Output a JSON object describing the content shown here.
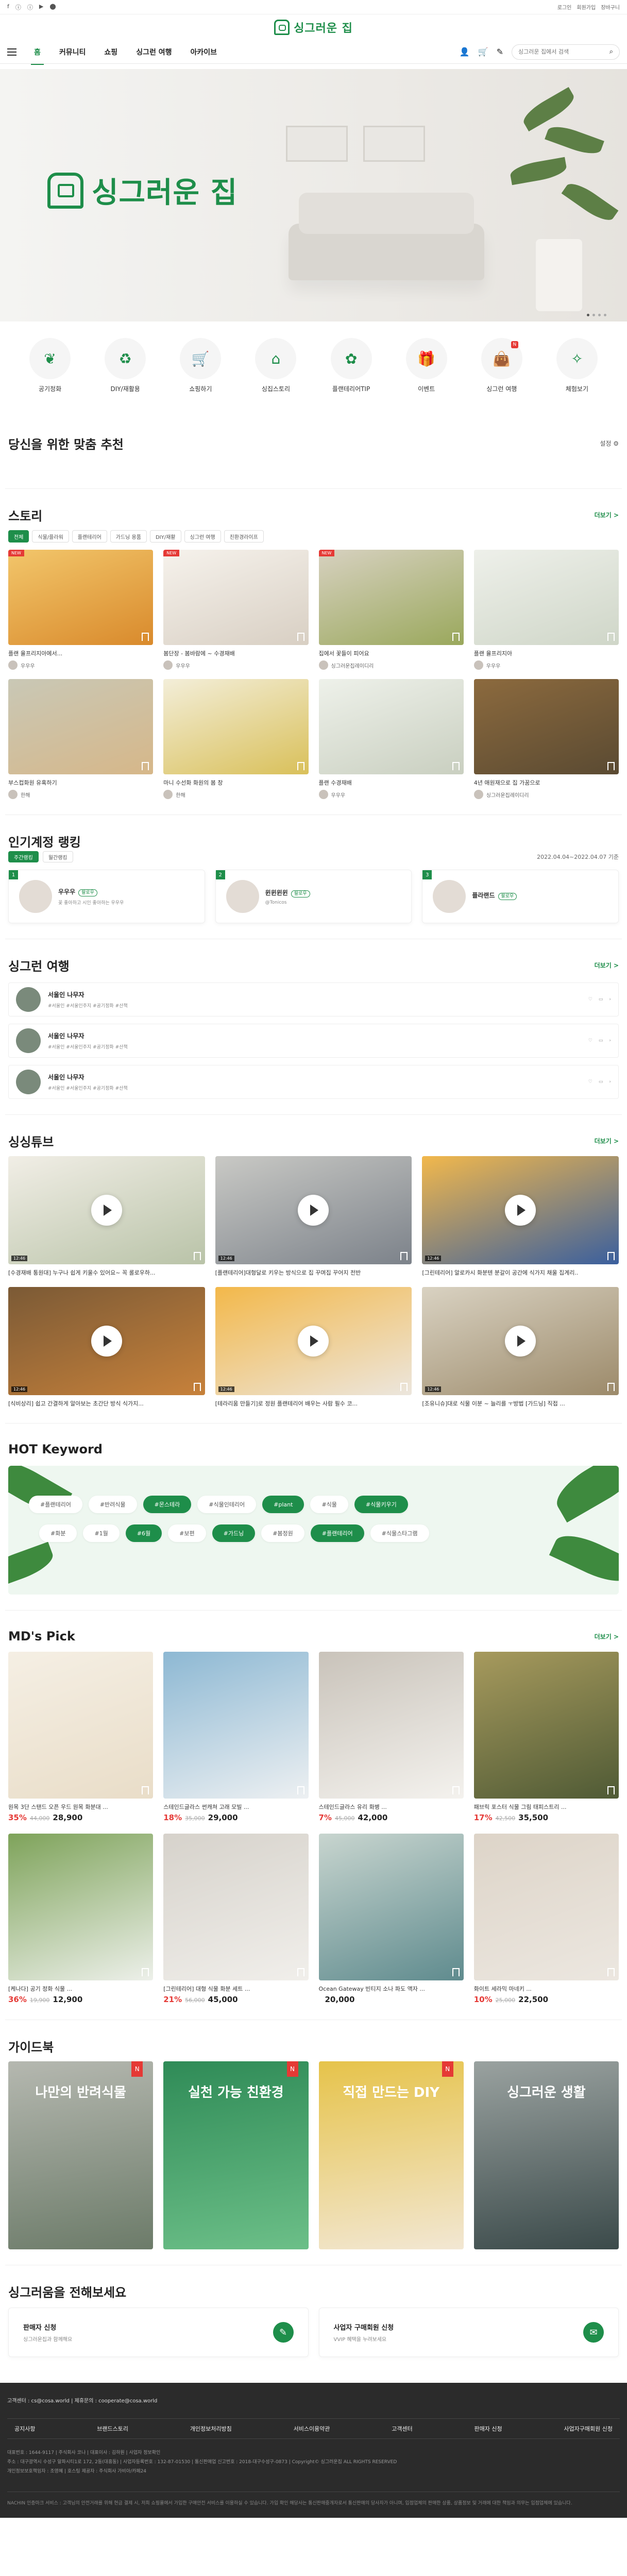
{
  "brand": {
    "name": "싱그러운 집",
    "hero_name": "싱그러운 집",
    "green": "#1e8e4a"
  },
  "util": {
    "left": [
      "f",
      "ⓘ",
      "ⓘ",
      "▶",
      "⬤"
    ],
    "right": [
      "로그인",
      "회원가입",
      "장바구니"
    ]
  },
  "nav": {
    "items": [
      "홈",
      "커뮤니티",
      "쇼핑",
      "싱그런 여행",
      "아카이브"
    ],
    "active": 0,
    "search_placeholder": "싱그러운 집에서 검색"
  },
  "quick": [
    {
      "label": "공기정화",
      "icon": "leaf-icon"
    },
    {
      "label": "DIY/재활용",
      "icon": "recycle-icon"
    },
    {
      "label": "쇼핑하기",
      "icon": "cart-icon"
    },
    {
      "label": "싱집스토리",
      "icon": "house-icon"
    },
    {
      "label": "플랜테리어TIP",
      "icon": "plant-icon"
    },
    {
      "label": "이벤트",
      "icon": "gift-icon"
    },
    {
      "label": "싱그런 여행",
      "icon": "bag-icon",
      "badge": "N"
    },
    {
      "label": "체험보기",
      "icon": "star-icon"
    }
  ],
  "reco": {
    "title": "당신을 위한 맞춤 추천",
    "right": "설정 ⚙"
  },
  "story": {
    "title": "스토리",
    "more": "더보기 >",
    "chips": [
      "전체",
      "식물/플라워",
      "플랜테리어",
      "가드닝 용품",
      "DIY/재활",
      "싱그런 여행",
      "친환경라이프"
    ],
    "cards": [
      {
        "title": "플랜 율프리지아에서...",
        "user": "우우우",
        "new": true,
        "colors": [
          "#d98a2c",
          "#f2c66b"
        ]
      },
      {
        "title": "봄단장 - 봄바람에 ~ 수경재배",
        "user": "우우우",
        "new": true,
        "colors": [
          "#d8cfc3",
          "#f6f2ec"
        ]
      },
      {
        "title": "집에서 꽃들이 피어요",
        "user": "싱그러운집레이디리",
        "new": true,
        "colors": [
          "#9aa85c",
          "#d7d1c0"
        ]
      },
      {
        "title": "플랜 율프리지아",
        "user": "우우우",
        "new": false,
        "colors": [
          "#cfd6c8",
          "#eef0ea"
        ]
      },
      {
        "title": "부스컵화원 유혹하기",
        "user": "한해",
        "new": false,
        "colors": [
          "#d6b789",
          "#c9c8b6"
        ]
      },
      {
        "title": "마니 수선화 화원의 봄 창",
        "user": "한해",
        "new": false,
        "colors": [
          "#d9c05a",
          "#f3eed9"
        ]
      },
      {
        "title": "플랜 수경재배",
        "user": "우우우",
        "new": false,
        "colors": [
          "#c9cfc0",
          "#eef1ea"
        ]
      },
      {
        "title": "4년 애원재으로 집 가꿈으로",
        "user": "싱그러운집레이디리",
        "new": false,
        "colors": [
          "#5a4a32",
          "#8c6a3e"
        ]
      }
    ]
  },
  "ranking": {
    "title": "인기계정 랭킹",
    "tabs": [
      "주간랭킹",
      "월간랭킹"
    ],
    "date": "2022.04.04~2022.04.07 기준",
    "items": [
      {
        "num": "1",
        "name": "우우우",
        "badge": "팔로우",
        "desc": "꽃 좋아하고 시인 좋아하는 우우우"
      },
      {
        "num": "2",
        "name": "윈윈윈윈",
        "badge": "팔로우",
        "desc": "@Tonicos"
      },
      {
        "num": "3",
        "name": "플라랜드",
        "badge": "팔로우",
        "desc": ""
      }
    ]
  },
  "trip": {
    "title": "싱그런 여행",
    "more": "더보기 >",
    "rows": [
      {
        "name": "서울인 나무자",
        "tags": "#서울인 #서울인주지 #공기정화 #산책"
      },
      {
        "name": "서울인 나무자",
        "tags": "#서울인 #서울인주지 #공기정화 #산책"
      },
      {
        "name": "서울인 나무자",
        "tags": "#서울인 #서울인주지 #공기정화 #산책"
      }
    ]
  },
  "video": {
    "title": "싱싱튜브",
    "more": "더보기 >",
    "items": [
      {
        "title": "[수경재배 통원대] 누구나 쉽게 키울수 있어요~ 꼭 롤로우하...",
        "time": "12:46",
        "colors": [
          "#b9c3a8",
          "#f1eee6"
        ]
      },
      {
        "title": "[플랜테리어]대형달로 키우는 방식으로 집 꾸며집 꾸어지 전반",
        "time": "12:46",
        "colors": [
          "#7c828a",
          "#c9c9c5"
        ]
      },
      {
        "title": "[그린테리어] 알로카시 화분텐 분갈이 공간에 식가지 채울 집계리..",
        "time": "12:46",
        "colors": [
          "#3a5f9e",
          "#f2b84c"
        ]
      },
      {
        "title": "[식비상리] 쉽고 간결하게 알아보는 초간단 방식 식가지...",
        "time": "12:46",
        "colors": [
          "#c7813a",
          "#7b5a36"
        ]
      },
      {
        "title": "[테라리움 만들기]로 정원 플랜테리어 배우는 사람 필수 코...",
        "time": "12:46",
        "colors": [
          "#ece6dd",
          "#f3b84a"
        ]
      },
      {
        "title": "[조유니슈]대로 식물 이분 ~ 늘리를 ㅜ방법 [가드닝] 직접 ...",
        "time": "12:46",
        "colors": [
          "#9c8a6a",
          "#d9d2c2"
        ]
      }
    ]
  },
  "keyword": {
    "title": "HOT Keyword",
    "rows": [
      [
        {
          "t": "#플랜테리어",
          "g": false
        },
        {
          "t": "#반려식물",
          "g": false
        },
        {
          "t": "#몬스테라",
          "g": true
        },
        {
          "t": "#식물인테리어",
          "g": false
        },
        {
          "t": "#plant",
          "g": true
        },
        {
          "t": "#식물",
          "g": false
        },
        {
          "t": "#식물키우기",
          "g": true
        }
      ],
      [
        {
          "t": "#화분",
          "g": false
        },
        {
          "t": "#1월",
          "g": false
        },
        {
          "t": "#6월",
          "g": true
        },
        {
          "t": "#보편",
          "g": false
        },
        {
          "t": "#가드닝",
          "g": true
        },
        {
          "t": "#봄정원",
          "g": false
        },
        {
          "t": "#플랜테리어",
          "g": true
        },
        {
          "t": "#식물스타그램",
          "g": false
        }
      ]
    ]
  },
  "md": {
    "title": "MD's Pick",
    "more": "더보기 >",
    "items": [
      {
        "title": "원목 3단 스탠드 오픈 우드 원목 화분대 ...",
        "dc": "35%",
        "orig": "44,000",
        "price": "28,900",
        "colors": [
          "#e9ddc8",
          "#f5efe4"
        ]
      },
      {
        "title": "스테인드글라스 썬캐쳐 고래 모빌 ...",
        "dc": "18%",
        "orig": "35,000",
        "price": "29,000",
        "colors": [
          "#edf0f2",
          "#8db8d3"
        ]
      },
      {
        "title": "스테인드글라스 유리 화병 ...",
        "dc": "7%",
        "orig": "45,000",
        "price": "42,000",
        "colors": [
          "#f4f2ee",
          "#c9c3ba"
        ]
      },
      {
        "title": "패브릭 포스터 식물 그림 태피스트리 ...",
        "dc": "17%",
        "orig": "42,500",
        "price": "35,500",
        "colors": [
          "#4f5a35",
          "#a79a5d"
        ]
      },
      {
        "title": "[케나다] 공기 정화 식물 ...",
        "dc": "36%",
        "orig": "19,900",
        "price": "12,900",
        "colors": [
          "#edf0ea",
          "#7ea35a"
        ]
      },
      {
        "title": "[그린테리어] 대형 식물 화분 세트 ...",
        "dc": "21%",
        "orig": "56,000",
        "price": "45,000",
        "colors": [
          "#f1efeb",
          "#d6d2cb"
        ]
      },
      {
        "title": "Ocean Gateway 빈티지 소나 파도 액자 ...",
        "dc": "",
        "orig": "",
        "price": "20,000",
        "colors": [
          "#5f8b8e",
          "#c8d5cf"
        ]
      },
      {
        "title": "화이트 세라믹 마네키 ...",
        "dc": "10%",
        "orig": "25,000",
        "price": "22,500",
        "colors": [
          "#ece7e0",
          "#ddd4c8"
        ]
      }
    ]
  },
  "guide": {
    "title": "가이드북",
    "items": [
      {
        "t": "나만의 반려식물",
        "n": true,
        "colors": [
          "#b5b8b0",
          "#6c7b69"
        ]
      },
      {
        "t": "실천 가능 친환경",
        "n": true,
        "colors": [
          "#2f8b57",
          "#6cbf88"
        ]
      },
      {
        "t": "직접 만드는 DIY",
        "n": true,
        "colors": [
          "#e6c34a",
          "#f2e7d3"
        ]
      },
      {
        "t": "싱그러운 생활",
        "n": false,
        "colors": [
          "#9aa2a0",
          "#3b4a4a"
        ]
      }
    ]
  },
  "contact": {
    "title": "싱그러움을 전해보세요",
    "items": [
      {
        "t1": "판매자 신청",
        "t2": "싱그러운집과 함께해요",
        "icon": "✎"
      },
      {
        "t1": "사업자 구매회원 신청",
        "t2": "VVIP 혜택을 누려보세요",
        "icon": "✉"
      }
    ]
  },
  "footer": {
    "top": "고객센터 : cs@cosa.world | 제휴문의 : cooperate@cosa.world",
    "menu": [
      "공지사항",
      "브랜드스토리",
      "개인정보처리방침",
      "서비스이용약관",
      "고객센터",
      "판매자 신청",
      "사업자구매회원 신청"
    ],
    "info1": "대표번호 : 1644-9117 | 주식회사 코나 | 대표이사 : 김하원 | 사업자 정보확인",
    "info2": "주소 : 대구광역시 수성구 알파시티1로 172, 2동(대흥동) | 사업자등록번호 : 132-87-01530 | 통신판매업 신고번호 : 2018-대구수성구-0873 | Copyright© 싱그러운집 ALL RIGHTS RESERVED",
    "info3": "개인정보보호책임자 : 조영혜 | 호스팅 제공자 : 주식회사 가비아/카페24",
    "bottom": "NACHIN 인증마크 서비스 : 고객님의 안전거래를 위해 현금 결제 시, 저희 쇼핑몰에서 가입한 구매안전 서비스를 이용하실 수 있습니다. 가입 확인 해당사는 통신판매중개자로서 통신판매의 당사자가 아니며, 입점업체의 판매한 상품, 상품정보 및 거래에 대한 책임과 의무는 입점업체에 있습니다."
  }
}
